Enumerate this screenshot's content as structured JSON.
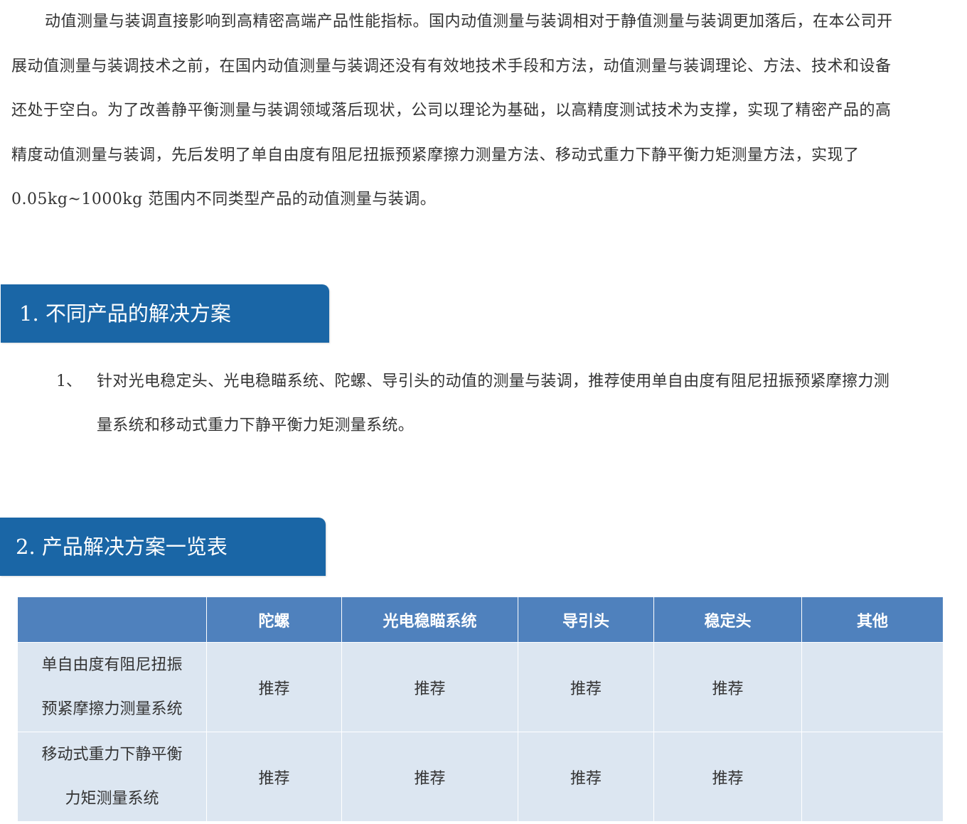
{
  "intro": {
    "lines": [
      "动值测量与装调直接影响到高精密高端产品性能指标。国内动值测量与装调相对于静值测量与装调更加落后，在本公司开",
      "展动值测量与装调技术之前，在国内动值测量与装调还没有有效地技术手段和方法，动值测量与装调理论、方法、技术和设备",
      "还处于空白。为了改善静平衡测量与装调领域落后现状，公司以理论为基础，以高精度测试技术为支撑，实现了精密产品的高",
      "精度动值测量与装调，先后发明了单自由度有阻尼扭振预紧摩擦力测量方法、移动式重力下静平衡力矩测量方法，实现了",
      "0.05kg~1000kg 范围内不同类型产品的动值测量与装调。"
    ]
  },
  "section1": {
    "title": "1.  不同产品的解决方案",
    "item": {
      "number": "1、",
      "lines": [
        "针对光电稳定头、光电稳瞄系统、陀螺、导引头的动值的测量与装调，推荐使用单自由度有阻尼扭振预紧摩擦力测",
        "量系统和移动式重力下静平衡力矩测量系统。"
      ]
    }
  },
  "section2": {
    "title": "2.  产品解决方案一览表"
  },
  "table": {
    "headers": [
      "",
      "陀螺",
      "光电稳瞄系统",
      "导引头",
      "稳定头",
      "其他"
    ],
    "rows": [
      {
        "name_lines": [
          "单自由度有阻尼扭振",
          "预紧摩擦力测量系统"
        ],
        "cells": [
          "推荐",
          "推荐",
          "推荐",
          "推荐",
          ""
        ]
      },
      {
        "name_lines": [
          "移动式重力下静平衡",
          "力矩测量系统"
        ],
        "cells": [
          "推荐",
          "推荐",
          "推荐",
          "推荐",
          ""
        ]
      }
    ]
  },
  "colors": {
    "section_header_bg": "#1a66a6",
    "table_header_bg": "#4f81bd",
    "table_cell_bg": "#dce6f1"
  }
}
